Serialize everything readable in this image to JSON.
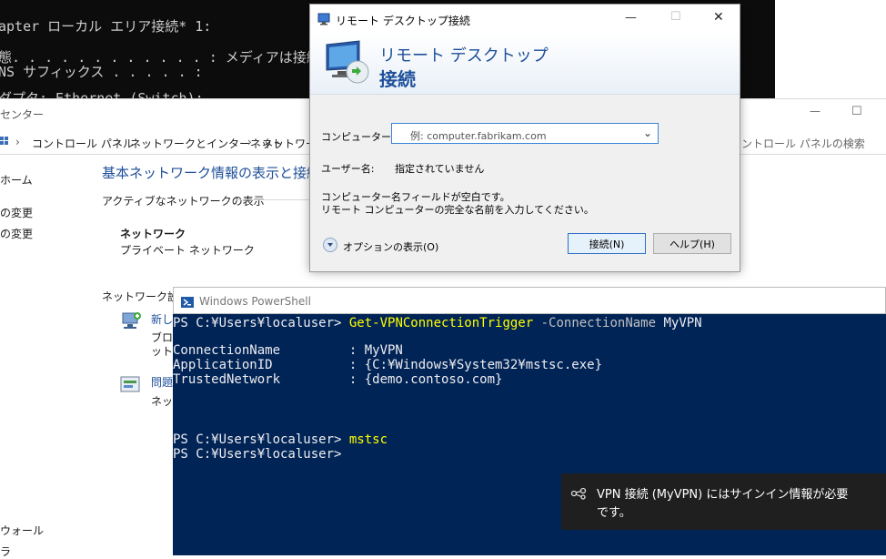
{
  "cmd": {
    "lines": [
      "apter ローカル エリア接続* 1:",
      "態. . . . . . . . . . . . : メディアは接続さ",
      "NS サフィックス . . . . . :",
      "ダプタ: Ethernet (Switch):"
    ]
  },
  "nsc": {
    "title": "センター",
    "breadcrumb": [
      "コントロール パネル",
      "ネットワークとインターネット",
      "ネットワーク"
    ],
    "search_placeholder": "ントロール パネルの検索",
    "sidebar": [
      "ホーム",
      "の変更",
      "の変更",
      "ウォール",
      "ラ"
    ],
    "heading": "基本ネットワーク情報の表示と接続の",
    "active_label": "アクティブなネットワークの表示",
    "network_name": "ネットワーク",
    "network_type": "プライベート ネットワーク",
    "settings_label": "ネットワーク設定",
    "item1_title": "新し",
    "item1_desc1": "ブロー",
    "item1_desc2": "ットア",
    "item2_title": "問題",
    "item2_desc": "ネット",
    "min_glyph": "—",
    "max_glyph": "☐"
  },
  "rdp": {
    "title": "リモート デスクトップ接続",
    "banner_line1": "リモート デスクトップ",
    "banner_line2": "接続",
    "computer_label": "コンピューター(C):",
    "computer_placeholder": "例: computer.fabrikam.com",
    "user_label": "ユーザー名:",
    "user_value": "指定されていません",
    "message_line1": "コンピューター名フィールドが空白です。",
    "message_line2": "リモート コンピューターの完全な名前を入力してください。",
    "options_label": "オプションの表示(O)",
    "connect_label": "接続(N)",
    "help_label": "ヘルプ(H)",
    "min_glyph": "—",
    "max_glyph": "☐",
    "close_glyph": "✕"
  },
  "ps": {
    "title": "Windows PowerShell",
    "prompt": "PS C:¥Users¥localuser> ",
    "cmd1": "Get-VPNConnectionTrigger",
    "cmd1_param": " -ConnectionName",
    "cmd1_value": " MyVPN",
    "output": [
      "ConnectionName         : MyVPN",
      "ApplicationID          : {C:¥Windows¥System32¥mstsc.exe}",
      "TrustedNetwork         : {demo.contoso.com}"
    ],
    "cmd2": "mstsc"
  },
  "toast": {
    "line1": "VPN 接続 (MyVPN) にはサインイン情報が必要",
    "line2": "です。"
  }
}
